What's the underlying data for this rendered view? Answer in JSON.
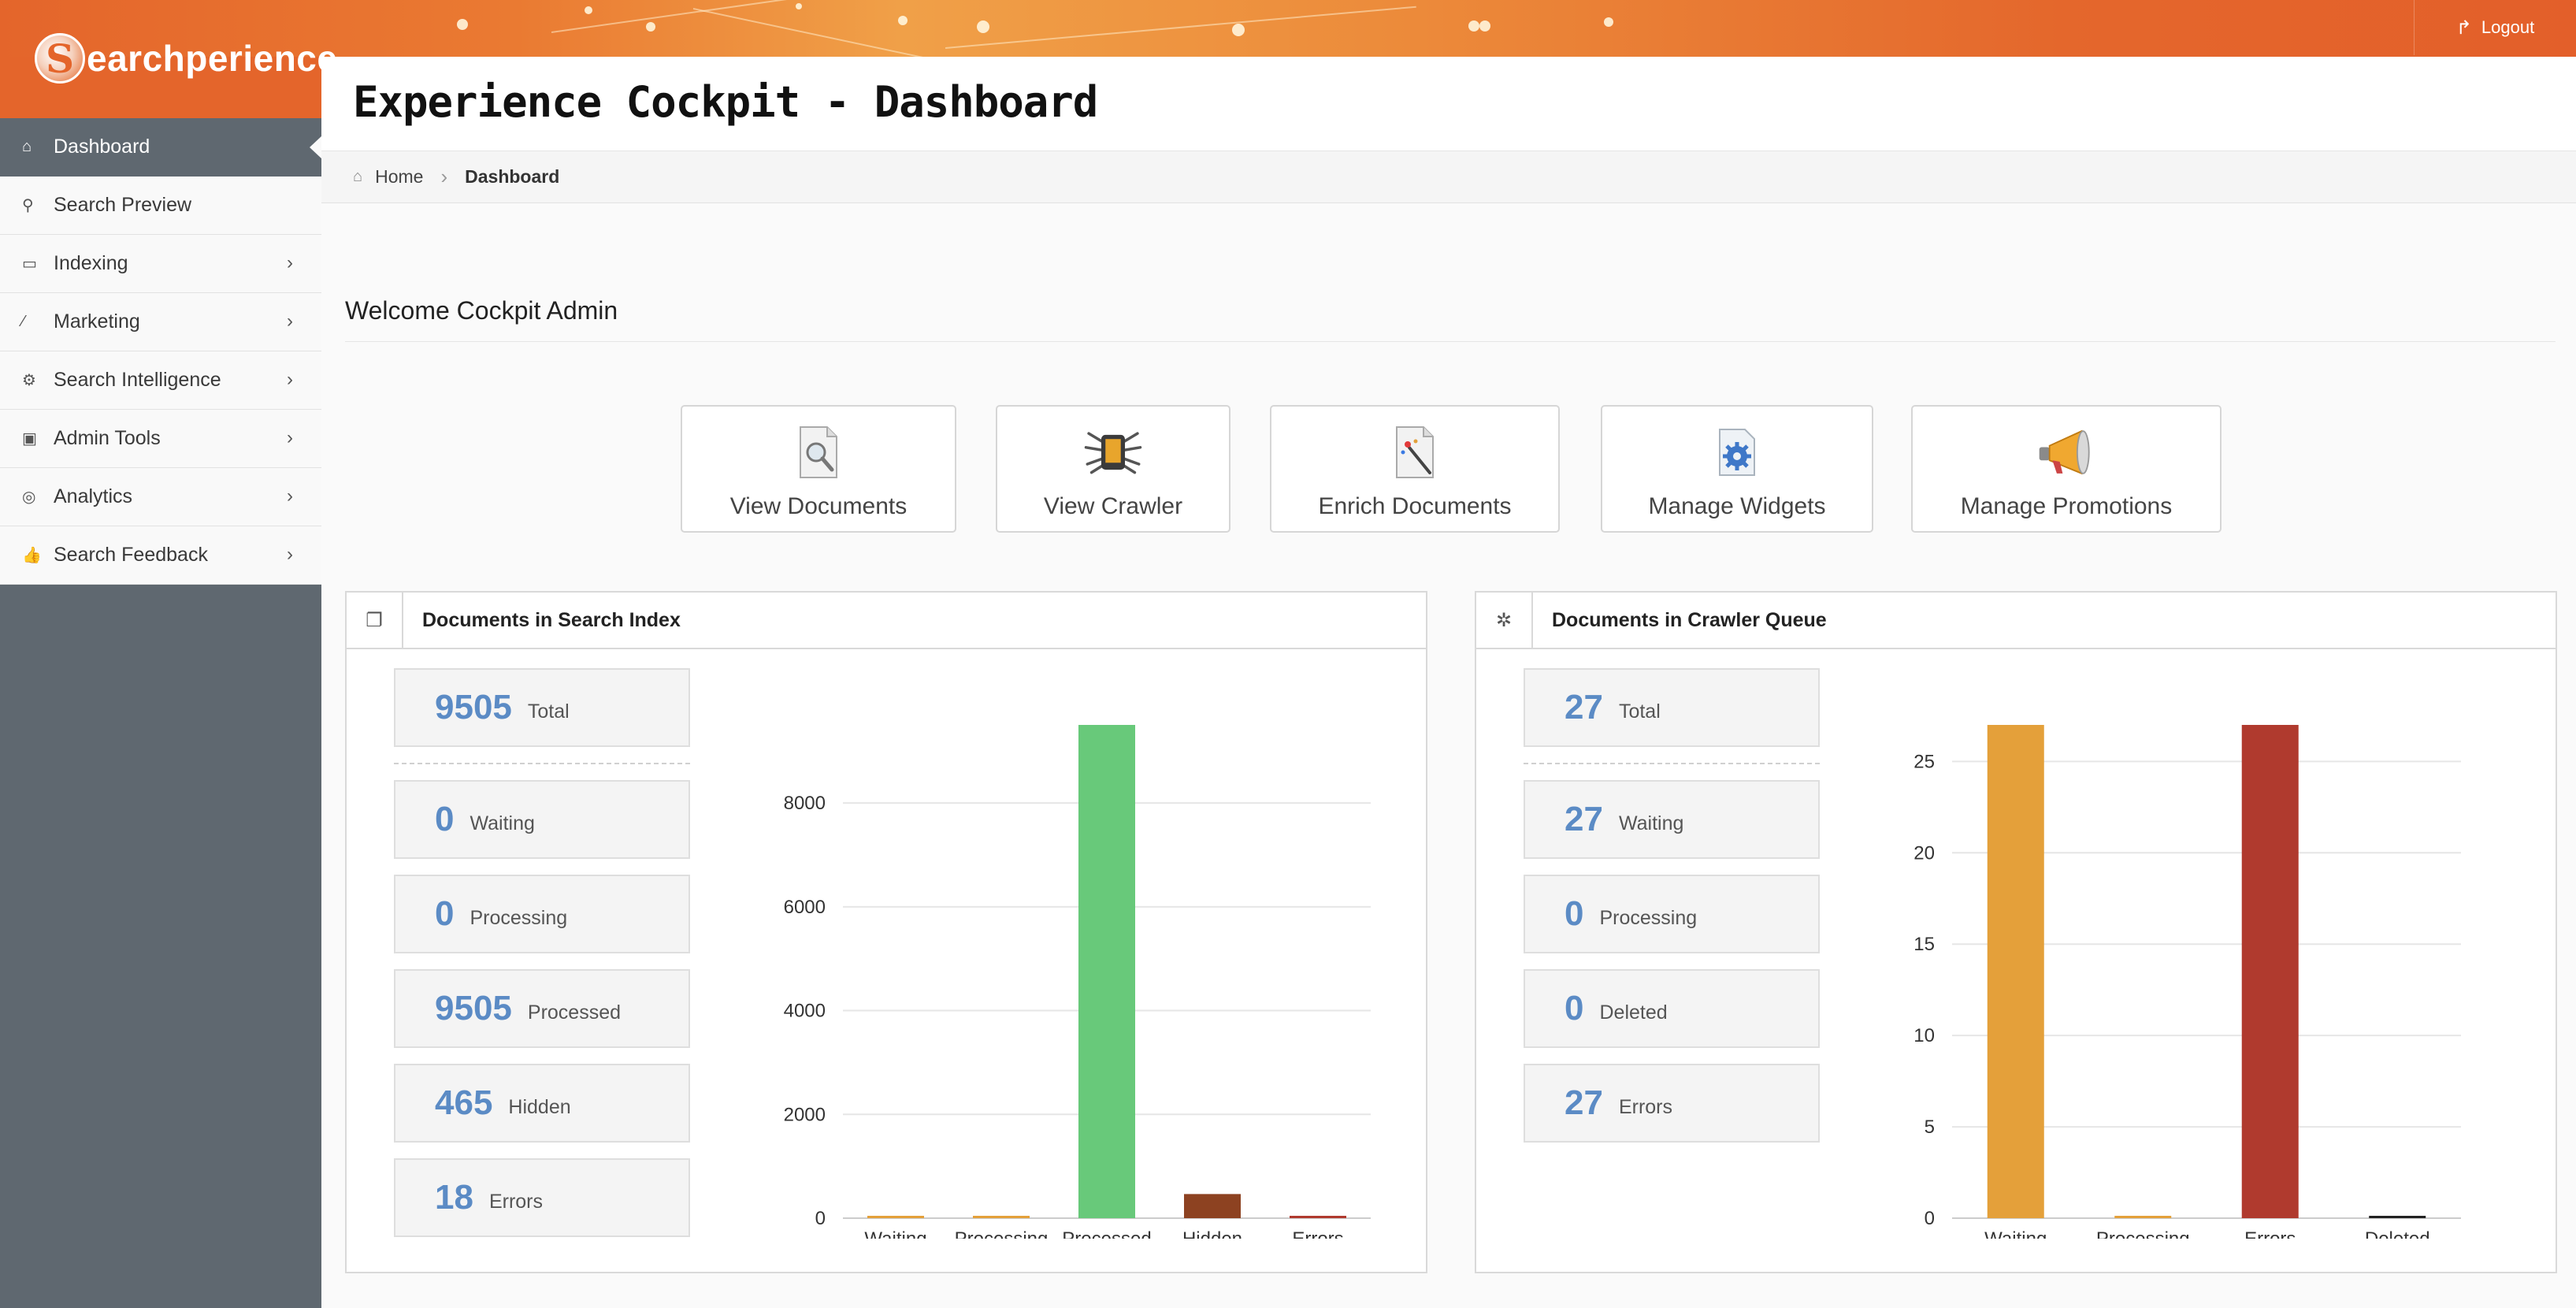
{
  "app": {
    "logo_text": "earchperience",
    "logo_letter": "S"
  },
  "topbar": {
    "logout_label": "Logout"
  },
  "sidebar": {
    "items": [
      {
        "label": "Dashboard",
        "icon": "home-icon",
        "active": true,
        "submenu": false
      },
      {
        "label": "Search Preview",
        "icon": "search-icon",
        "active": false,
        "submenu": false
      },
      {
        "label": "Indexing",
        "icon": "inbox-icon",
        "active": false,
        "submenu": true
      },
      {
        "label": "Marketing",
        "icon": "magic-wand-icon",
        "active": false,
        "submenu": true
      },
      {
        "label": "Search Intelligence",
        "icon": "gear-icon",
        "active": false,
        "submenu": true
      },
      {
        "label": "Admin Tools",
        "icon": "lock-icon",
        "active": false,
        "submenu": true
      },
      {
        "label": "Analytics",
        "icon": "dashboard-gauge-icon",
        "active": false,
        "submenu": true
      },
      {
        "label": "Search Feedback",
        "icon": "thumbs-up-icon",
        "active": false,
        "submenu": true
      }
    ]
  },
  "header": {
    "title": "Experience Cockpit - Dashboard"
  },
  "breadcrumb": {
    "home": "Home",
    "current": "Dashboard"
  },
  "welcome": "Welcome Cockpit Admin",
  "quick_actions": [
    {
      "label": "View Documents",
      "icon": "document-magnifier-icon"
    },
    {
      "label": "View Crawler",
      "icon": "crawler-spider-icon"
    },
    {
      "label": "Enrich Documents",
      "icon": "document-wand-icon"
    },
    {
      "label": "Manage Widgets",
      "icon": "widget-gear-icon"
    },
    {
      "label": "Manage Promotions",
      "icon": "megaphone-icon"
    }
  ],
  "index_panel": {
    "title": "Documents in Search Index",
    "icon": "copy-documents-icon",
    "stats": [
      {
        "value": "9505",
        "label": "Total"
      },
      {
        "value": "0",
        "label": "Waiting"
      },
      {
        "value": "0",
        "label": "Processing"
      },
      {
        "value": "9505",
        "label": "Processed"
      },
      {
        "value": "465",
        "label": "Hidden"
      },
      {
        "value": "18",
        "label": "Errors"
      }
    ]
  },
  "crawler_panel": {
    "title": "Documents in Crawler Queue",
    "icon": "bug-icon",
    "stats": [
      {
        "value": "27",
        "label": "Total"
      },
      {
        "value": "27",
        "label": "Waiting"
      },
      {
        "value": "0",
        "label": "Processing"
      },
      {
        "value": "0",
        "label": "Deleted"
      },
      {
        "value": "27",
        "label": "Errors"
      }
    ]
  },
  "chart_data": [
    {
      "type": "bar",
      "categories": [
        "Waiting",
        "Processing",
        "Processed",
        "Hidden",
        "Errors"
      ],
      "values": [
        0,
        0,
        9505,
        465,
        18
      ],
      "colors": [
        "#e4a03a",
        "#e4a03a",
        "#68c97a",
        "#8d4221",
        "#b03a2e"
      ],
      "ylim": [
        0,
        9505
      ],
      "yticks": [
        0,
        2000,
        4000,
        6000,
        8000
      ],
      "grid": true
    },
    {
      "type": "bar",
      "categories": [
        "Waiting",
        "Processing",
        "Errors",
        "Deleted"
      ],
      "values": [
        27,
        0,
        27,
        0
      ],
      "colors": [
        "#e4a03a",
        "#e4a03a",
        "#b03a2e",
        "#222222"
      ],
      "ylim": [
        0,
        27
      ],
      "yticks": [
        0,
        5,
        10,
        15,
        20,
        25
      ],
      "grid": true
    }
  ]
}
